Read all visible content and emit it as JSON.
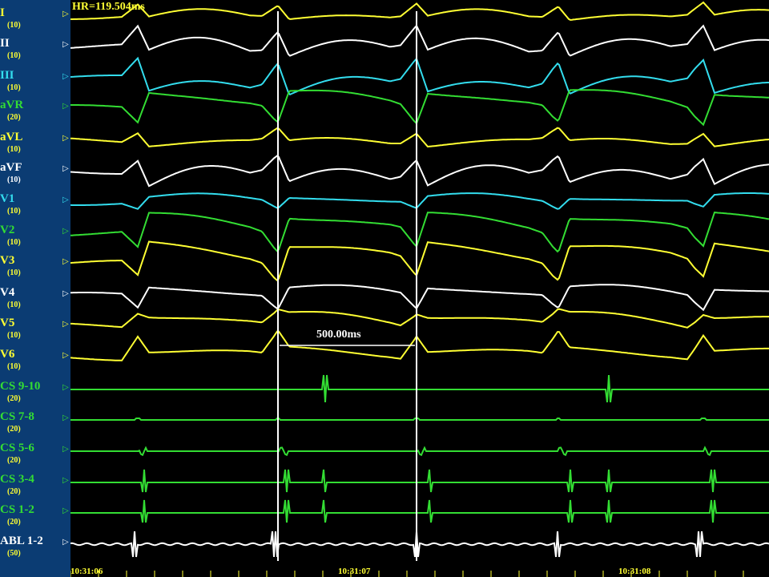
{
  "heart_rate_label": "HR=119.504ms",
  "measurement_label": "500.00ms",
  "channels": [
    {
      "name": "I",
      "gain": "(10)",
      "color": "#ffff33",
      "gain_color": "#ffff33"
    },
    {
      "name": "II",
      "gain": "(10)",
      "color": "#ffffff",
      "gain_color": "#ffff33"
    },
    {
      "name": "III",
      "gain": "(10)",
      "color": "#33ddee",
      "gain_color": "#ffff33"
    },
    {
      "name": "aVR",
      "gain": "(20)",
      "color": "#33dd33",
      "gain_color": "#ffff33"
    },
    {
      "name": "aVL",
      "gain": "(10)",
      "color": "#ffff33",
      "gain_color": "#ffff33"
    },
    {
      "name": "aVF",
      "gain": "(10)",
      "color": "#ffffff",
      "gain_color": "#ffffff"
    },
    {
      "name": "V1",
      "gain": "(10)",
      "color": "#33ddee",
      "gain_color": "#ffff33"
    },
    {
      "name": "V2",
      "gain": "(10)",
      "color": "#33dd33",
      "gain_color": "#ffff33"
    },
    {
      "name": "V3",
      "gain": "(10)",
      "color": "#ffff33",
      "gain_color": "#ffff33"
    },
    {
      "name": "V4",
      "gain": "(10)",
      "color": "#ffffff",
      "gain_color": "#ffff33"
    },
    {
      "name": "V5",
      "gain": "(10)",
      "color": "#ffff33",
      "gain_color": "#ffff33"
    },
    {
      "name": "V6",
      "gain": "(10)",
      "color": "#ffff33",
      "gain_color": "#ffff33"
    },
    {
      "name": "CS 9-10",
      "gain": "(20)",
      "color": "#33dd33",
      "gain_color": "#ffff33"
    },
    {
      "name": "CS 7-8",
      "gain": "(20)",
      "color": "#33dd33",
      "gain_color": "#ffff33"
    },
    {
      "name": "CS 5-6",
      "gain": "(20)",
      "color": "#33dd33",
      "gain_color": "#ffff33"
    },
    {
      "name": "CS 3-4",
      "gain": "(20)",
      "color": "#33dd33",
      "gain_color": "#ffff33"
    },
    {
      "name": "CS 1-2",
      "gain": "(20)",
      "color": "#33dd33",
      "gain_color": "#ffff33"
    },
    {
      "name": "ABL 1-2",
      "gain": "(50)",
      "color": "#ffffff",
      "gain_color": "#ffff33"
    }
  ],
  "time_labels": [
    "10:31:06",
    "10:31:07",
    "10:31:08"
  ],
  "marker_glyph": "▷",
  "chart_data": {
    "type": "line",
    "title": "",
    "xlabel": "",
    "ylabel": "",
    "series": [
      {
        "name": "I"
      },
      {
        "name": "II"
      },
      {
        "name": "III"
      },
      {
        "name": "aVR"
      },
      {
        "name": "aVL"
      },
      {
        "name": "aVF"
      },
      {
        "name": "V1"
      },
      {
        "name": "V2"
      },
      {
        "name": "V3"
      },
      {
        "name": "V4"
      },
      {
        "name": "V5"
      },
      {
        "name": "V6"
      },
      {
        "name": "CS 9-10"
      },
      {
        "name": "CS 7-8"
      },
      {
        "name": "CS 5-6"
      },
      {
        "name": "CS 3-4"
      },
      {
        "name": "CS 1-2"
      },
      {
        "name": "ABL 1-2"
      }
    ],
    "x_tick_labels": [
      "10:31:06",
      "10:31:07",
      "10:31:08"
    ],
    "caliper_interval_ms": 500.0,
    "grid": false
  }
}
